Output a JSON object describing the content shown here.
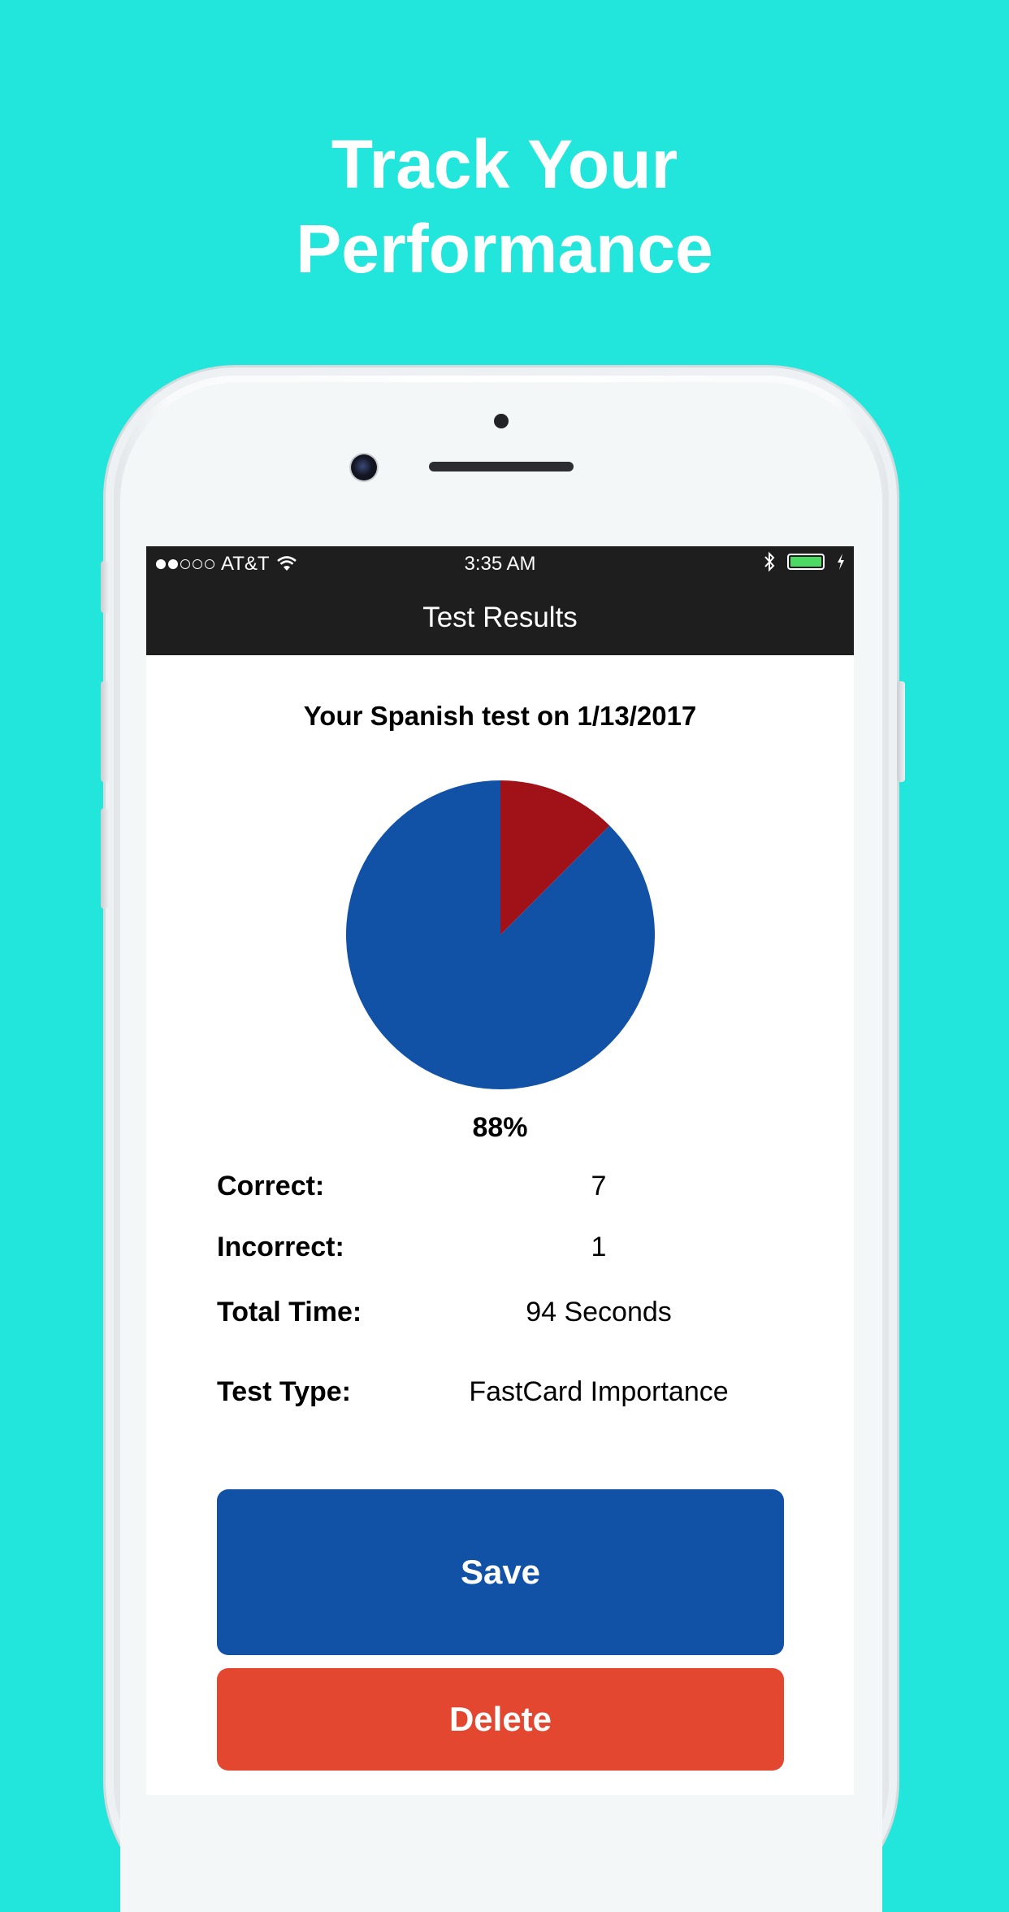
{
  "headline": {
    "line1": "Track Your",
    "line2": "Performance"
  },
  "status_bar": {
    "signal": {
      "filled": 2,
      "total": 5
    },
    "carrier": "AT&T",
    "time": "3:35 AM",
    "battery_level": 1.0,
    "battery_color": "#4cd964"
  },
  "nav": {
    "title": "Test Results"
  },
  "results": {
    "heading": "Your Spanish test on 1/13/2017",
    "percent_label": "88%",
    "stats": [
      {
        "label": "Correct:",
        "value": "7"
      },
      {
        "label": "Incorrect:",
        "value": "1"
      },
      {
        "label": "Total Time:",
        "value": "94 Seconds"
      },
      {
        "label": "Test Type:",
        "value": "FastCard Importance"
      }
    ]
  },
  "chart_data": {
    "type": "pie",
    "slices": [
      {
        "label": "Correct",
        "value": 7,
        "color": "#1151A6"
      },
      {
        "label": "Incorrect",
        "value": 1,
        "color": "#A01118"
      }
    ]
  },
  "buttons": {
    "save_label": "Save",
    "delete_label": "Delete"
  },
  "colors": {
    "background": "#22E6DC",
    "save": "#1151A6",
    "delete": "#E4472F"
  }
}
